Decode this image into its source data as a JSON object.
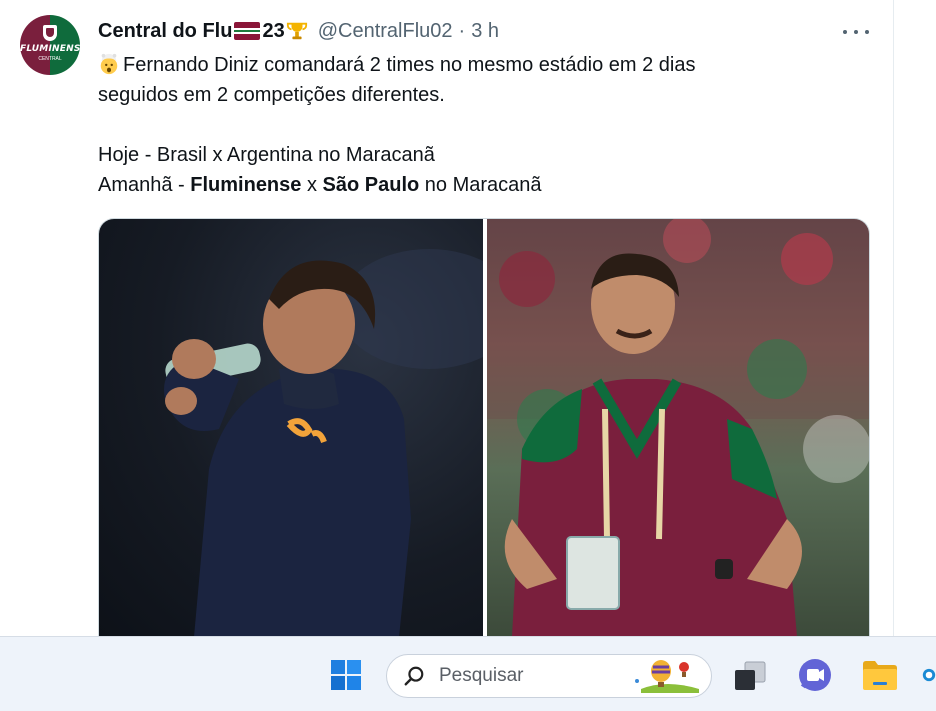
{
  "tweet": {
    "display_name": "Central do Flu",
    "name_number": "23",
    "handle": "@CentralFlu02",
    "separator": "·",
    "time": "3 h",
    "avatar_text": "FLUMINENSE",
    "avatar_subtext": "CENTRAL",
    "text_line1": "Fernando Diniz comandará 2 times no mesmo estádio em 2 dias",
    "text_line2": "seguidos em 2 competições diferentes.",
    "line_hoje": "Hoje - Brasil x Argentina no Maracanã",
    "amanha_prefix": "Amanhã - ",
    "amanha_team1": "Fluminense",
    "amanha_x": " x ",
    "amanha_team2": "São Paulo",
    "amanha_suffix": " no Maracanã",
    "icons": {
      "flag": "flag-icon",
      "trophy": "trophy-icon",
      "emoji": "exploding-head-emoji",
      "more": "more-options-icon"
    }
  },
  "media": {
    "photos": [
      {
        "name": "coach-drinking-photo",
        "description_icon": "photo"
      },
      {
        "name": "coach-fluminense-photo",
        "description_icon": "photo"
      }
    ]
  },
  "taskbar": {
    "search_placeholder": "Pesquisar",
    "icons": [
      "windows-start-icon",
      "search-icon",
      "task-view-icon",
      "teams-chat-icon",
      "file-explorer-icon"
    ]
  },
  "colors": {
    "text_primary": "#0f1419",
    "text_secondary": "#536471",
    "fluminense_maroon": "#7a1f3d",
    "fluminense_green": "#0f6b3c",
    "taskbar_bg": "#eef3fa"
  }
}
